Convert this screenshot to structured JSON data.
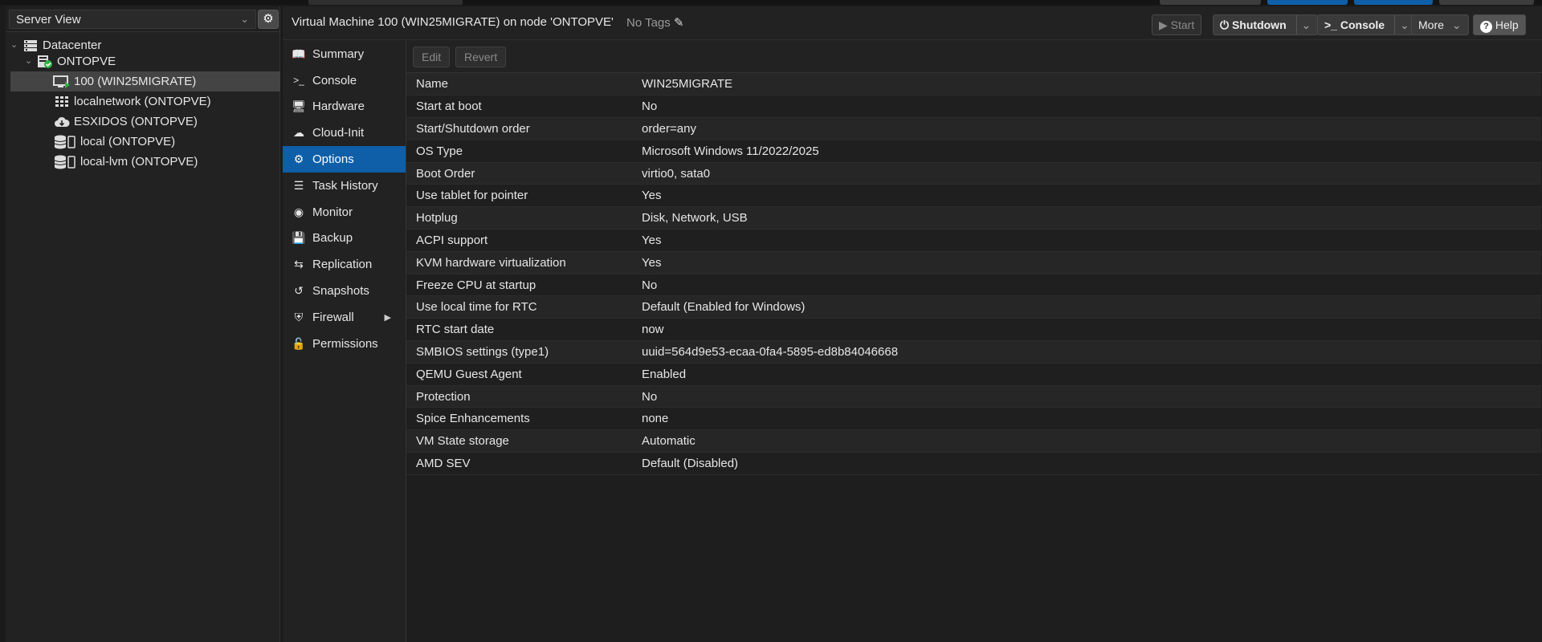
{
  "tree": {
    "view_select": "Server View",
    "nodes": [
      {
        "label": "Datacenter",
        "icon": "datacenter-icon"
      },
      {
        "label": "ONTOPVE",
        "icon": "node-icon"
      },
      {
        "label": "100 (WIN25MIGRATE)",
        "icon": "vm-running-icon"
      },
      {
        "label": "localnetwork (ONTOPVE)",
        "icon": "network-grid-icon"
      },
      {
        "label": "ESXIDOS (ONTOPVE)",
        "icon": "cloud-storage-icon"
      },
      {
        "label": "local (ONTOPVE)",
        "icon": "storage-icon"
      },
      {
        "label": "local-lvm (ONTOPVE)",
        "icon": "storage-icon"
      }
    ]
  },
  "header": {
    "title": "Virtual Machine 100 (WIN25MIGRATE) on node 'ONTOPVE'",
    "tags": "No Tags",
    "start": "Start",
    "shutdown": "Shutdown",
    "console": "Console",
    "more": "More",
    "help": "Help"
  },
  "nav": [
    {
      "label": "Summary",
      "icon": "summary-icon"
    },
    {
      "label": "Console",
      "icon": "terminal-icon"
    },
    {
      "label": "Hardware",
      "icon": "monitor-icon"
    },
    {
      "label": "Cloud-Init",
      "icon": "cloud-icon"
    },
    {
      "label": "Options",
      "icon": "gear-icon"
    },
    {
      "label": "Task History",
      "icon": "list-icon"
    },
    {
      "label": "Monitor",
      "icon": "eye-icon"
    },
    {
      "label": "Backup",
      "icon": "floppy-icon"
    },
    {
      "label": "Replication",
      "icon": "retweet-icon"
    },
    {
      "label": "Snapshots",
      "icon": "history-icon"
    },
    {
      "label": "Firewall",
      "icon": "shield-icon"
    },
    {
      "label": "Permissions",
      "icon": "unlock-icon"
    }
  ],
  "toolbar": {
    "edit": "Edit",
    "revert": "Revert"
  },
  "options": [
    {
      "key": "Name",
      "value": "WIN25MIGRATE"
    },
    {
      "key": "Start at boot",
      "value": "No"
    },
    {
      "key": "Start/Shutdown order",
      "value": "order=any"
    },
    {
      "key": "OS Type",
      "value": "Microsoft Windows 11/2022/2025"
    },
    {
      "key": "Boot Order",
      "value": "virtio0, sata0"
    },
    {
      "key": "Use tablet for pointer",
      "value": "Yes"
    },
    {
      "key": "Hotplug",
      "value": "Disk, Network, USB"
    },
    {
      "key": "ACPI support",
      "value": "Yes"
    },
    {
      "key": "KVM hardware virtualization",
      "value": "Yes"
    },
    {
      "key": "Freeze CPU at startup",
      "value": "No"
    },
    {
      "key": "Use local time for RTC",
      "value": "Default (Enabled for Windows)"
    },
    {
      "key": "RTC start date",
      "value": "now"
    },
    {
      "key": "SMBIOS settings (type1)",
      "value": "uuid=564d9e53-ecaa-0fa4-5895-ed8b84046668"
    },
    {
      "key": "QEMU Guest Agent",
      "value": "Enabled"
    },
    {
      "key": "Protection",
      "value": "No"
    },
    {
      "key": "Spice Enhancements",
      "value": "none"
    },
    {
      "key": "VM State storage",
      "value": "Automatic"
    },
    {
      "key": "AMD SEV",
      "value": "Default (Disabled)"
    }
  ],
  "colors": {
    "accent": "#0e5fa8",
    "running": "#2fb344"
  }
}
